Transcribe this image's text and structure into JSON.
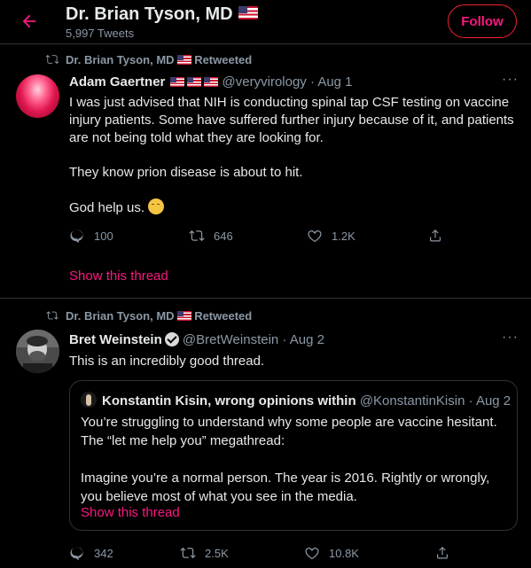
{
  "header": {
    "title": "Dr. Brian Tyson, MD",
    "tweet_count": "5,997 Tweets",
    "follow_label": "Follow"
  },
  "tweets": [
    {
      "retweeted_by": "Dr. Brian Tyson, MD",
      "retweeted_label": "Retweeted",
      "author_name": "Adam Gaertner",
      "author_handle": "@veryvirology",
      "date": "Aug 1",
      "paragraphs": [
        "I was just advised that NIH is conducting spinal tap CSF testing on vaccine injury patients. Some have suffered further injury because of it, and patients are not being told what they are looking for.",
        "They know prion disease is about to hit.",
        "God help us."
      ],
      "replies": "100",
      "retweets": "646",
      "likes": "1.2K",
      "show_thread": "Show this thread"
    },
    {
      "retweeted_by": "Dr. Brian Tyson, MD",
      "retweeted_label": "Retweeted",
      "author_name": "Bret Weinstein",
      "author_handle": "@BretWeinstein",
      "date": "Aug 2",
      "text": "This is an incredibly good thread.",
      "quote": {
        "author_name": "Konstantin Kisin, wrong opinions within",
        "author_handle": "@KonstantinKisin",
        "date": "Aug 2",
        "paragraphs": [
          "You’re struggling to understand why some people are vaccine hesitant. The “let me help you” megathread:",
          "Imagine you’re a normal person. The year is 2016. Rightly or wrongly, you believe most of what you see in the media."
        ],
        "show_thread": "Show this thread"
      },
      "replies": "342",
      "retweets": "2.5K",
      "likes": "10.8K"
    }
  ],
  "colors": {
    "accent": "#f91880",
    "background": "#000000",
    "muted": "#8b98a5",
    "border": "#2f3336"
  },
  "icons": [
    "back-arrow-icon",
    "retweet-icon",
    "reply-icon",
    "like-icon",
    "share-icon",
    "more-icon",
    "verified-badge-icon",
    "us-flag-icon"
  ]
}
